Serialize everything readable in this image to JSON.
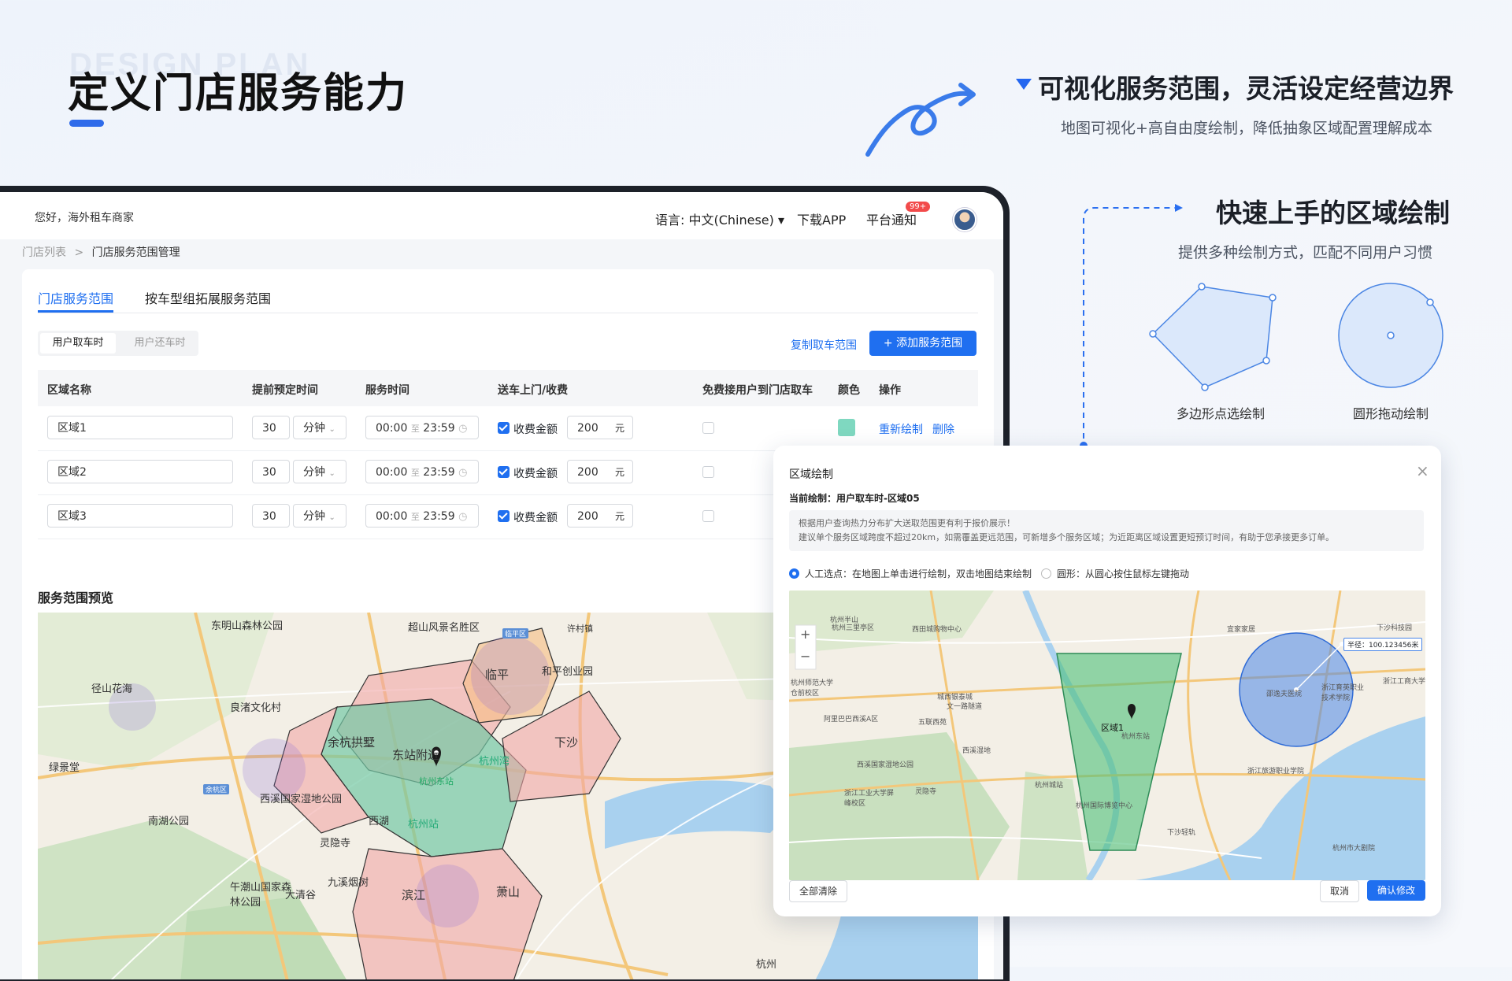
{
  "marketing": {
    "ghost_text": "DESIGN PLAN",
    "title": "定义门店服务能力",
    "feature1_title": "可视化服务范围，灵活设定经营边界",
    "feature1_subtitle": "地图可视化+高自由度绘制，降低抽象区域配置理解成本",
    "feature2_title": "快速上手的区域绘制",
    "feature2_subtitle": "提供多种绘制方式，匹配不同用户习惯",
    "polygon_label": "多边形点选绘制",
    "circle_label": "圆形拖动绘制"
  },
  "app": {
    "greeting": "您好，海外租车商家",
    "language": "语言: 中文(Chinese)",
    "download": "下载APP",
    "notice": "平台通知",
    "notice_badge": "99+",
    "breadcrumb_parent": "门店列表",
    "breadcrumb_sep": ">",
    "breadcrumb_current": "门店服务范围管理",
    "tabs": [
      "门店服务范围",
      "按车型组拓展服务范围"
    ],
    "segment": [
      "用户取车时",
      "用户还车时"
    ],
    "copy_link": "复制取车范围",
    "add_button": "+ 添加服务范围",
    "columns": [
      "区域名称",
      "提前预定时间",
      "服务时间",
      "送车上门/收费",
      "免费接用户到门店取车",
      "颜色",
      "操作"
    ],
    "rows": [
      {
        "name": "区域1",
        "advance": "30",
        "unit": "分钟",
        "start": "00:00",
        "to": "至",
        "end": "23:59",
        "fee_label": "收费金额",
        "fee": "200",
        "currency": "元"
      },
      {
        "name": "区域2",
        "advance": "30",
        "unit": "分钟",
        "start": "00:00",
        "to": "至",
        "end": "23:59",
        "fee_label": "收费金额",
        "fee": "200",
        "currency": "元"
      },
      {
        "name": "区域3",
        "advance": "30",
        "unit": "分钟",
        "start": "00:00",
        "to": "至",
        "end": "23:59",
        "fee_label": "收费金额",
        "fee": "200",
        "currency": "元"
      }
    ],
    "op_redraw": "重新绘制",
    "op_delete": "删除",
    "preview_title": "服务范围预览",
    "map_labels": [
      "东明山森林公园",
      "超山风景名胜区",
      "临平",
      "和平创业园",
      "径山花海",
      "良渚文化村",
      "余杭拱墅",
      "东站附近",
      "杭州东站",
      "下沙",
      "杭州湾",
      "绿景堂",
      "余杭区",
      "西溪国家湿地公园",
      "杭州站",
      "西湖",
      "南湖公园",
      "灵隐寺",
      "九溪烟树",
      "午潮山国家森林公园",
      "大清谷",
      "滨江",
      "萧山",
      "杭州",
      "许村镇",
      "临平区"
    ]
  },
  "dialog": {
    "title": "区域绘制",
    "current": "当前绘制：用户取车时-区域05",
    "tip_line1": "根据用户查询热力分布扩大送取范围更有利于报价展示！",
    "tip_line2": "建议单个服务区域跨度不超过20km，如需覆盖更远范围，可新增多个服务区域；为近距离区域设置更短预订时间，有助于您承接更多订单。",
    "option1": "人工选点：在地图上单击进行绘制，双击地图结束绘制",
    "option2": "圆形：从圆心按住鼠标左键拖动",
    "radius_label": "半径：100.123456米",
    "zone_label": "区域1",
    "clear_all": "全部清除",
    "cancel": "取消",
    "confirm": "确认修改",
    "zoom_in": "+",
    "zoom_out": "−",
    "map_labels": [
      "杭州半山",
      "杭州三里亭区",
      "西田城购物中心",
      "杭州师范大学仓前校区",
      "城西银泰城",
      "文一路隧道",
      "阿里巴巴西溪A区",
      "五联西苑",
      "西溪湿地",
      "西溪国家湿地公园",
      "浙江工业大学屏峰校区",
      "灵隐寺",
      "杭州城站",
      "杭州国际博览中心",
      "宜家家居",
      "下沙科技园",
      "杭州东站",
      "邵逸夫医院",
      "浙江旅游职业学院",
      "浙江工商大学",
      "杭州市大剧院",
      "下沙轻轨",
      "浙江育英职业技术学院"
    ]
  },
  "colors": {
    "accent": "#1f6ff0",
    "zone_green": "#7fd8c0",
    "zone_red": "#f08a8a",
    "zone_orange": "#f4b07c",
    "circle_blue": "#4a86e8"
  }
}
